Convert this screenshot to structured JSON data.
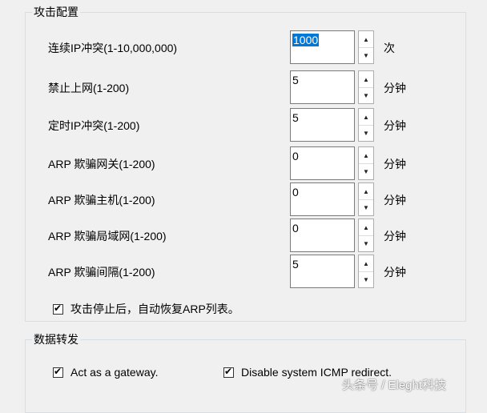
{
  "attack_group": {
    "title": "攻击配置",
    "rows": [
      {
        "label": "连续IP冲突(1-10,000,000)",
        "value": "1000",
        "unit": "次"
      },
      {
        "label": "禁止上网(1-200)",
        "value": "5",
        "unit": "分钟"
      },
      {
        "label": "定时IP冲突(1-200)",
        "value": "5",
        "unit": "分钟"
      },
      {
        "label": "ARP 欺骗网关(1-200)",
        "value": "0",
        "unit": "分钟"
      },
      {
        "label": "ARP 欺骗主机(1-200)",
        "value": "0",
        "unit": "分钟"
      },
      {
        "label": "ARP 欺骗局域网(1-200)",
        "value": "0",
        "unit": "分钟"
      },
      {
        "label": "ARP 欺骗间隔(1-200)",
        "value": "5",
        "unit": "分钟"
      }
    ],
    "restore_arp": {
      "label": "攻击停止后，自动恢复ARP列表。",
      "checked": true
    }
  },
  "forward_group": {
    "title": "数据转发",
    "gateway": {
      "label": "Act as a gateway.",
      "checked": true
    },
    "icmp": {
      "label": "Disable system ICMP redirect.",
      "checked": true
    }
  },
  "icons": {
    "check": "✔",
    "up": "▲",
    "down": "▼"
  },
  "watermark": "头条号 / Eleght科技"
}
